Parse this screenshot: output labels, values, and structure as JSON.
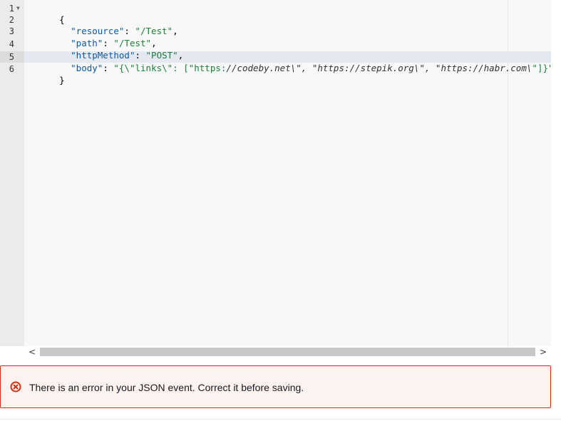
{
  "editor": {
    "line_numbers": [
      "1",
      "2",
      "3",
      "4",
      "5",
      "6"
    ],
    "lines": {
      "l1": {
        "open": "{"
      },
      "l2": {
        "key": "\"resource\"",
        "sep": ": ",
        "value": "\"/Test\"",
        "end": ","
      },
      "l3": {
        "key": "\"path\"",
        "sep": ": ",
        "value": "\"/Test\"",
        "end": ","
      },
      "l4": {
        "key": "\"httpMethod\"",
        "sep": ": ",
        "value": "\"POST\"",
        "end": ","
      },
      "l5": {
        "key": "\"body\"",
        "sep": ": ",
        "value_start": "\"{\\\"links\\\": [\"https:",
        "value_italic": "//codeby.net\\\", \"https://stepik.org\\\", \"https://habr.com\\",
        "value_end": "\"]}\""
      },
      "l6": {
        "close": "}"
      }
    },
    "active_line": "5",
    "fold_icon": "fold-arrow-icon"
  },
  "scrollbar": {
    "left_arrow": "<",
    "right_arrow": ">"
  },
  "alert": {
    "icon": "error-circle-x-icon",
    "message": "There is an error in your JSON event. Correct it before saving.",
    "border_color": "#d13212",
    "background": "#fcf3f1"
  }
}
